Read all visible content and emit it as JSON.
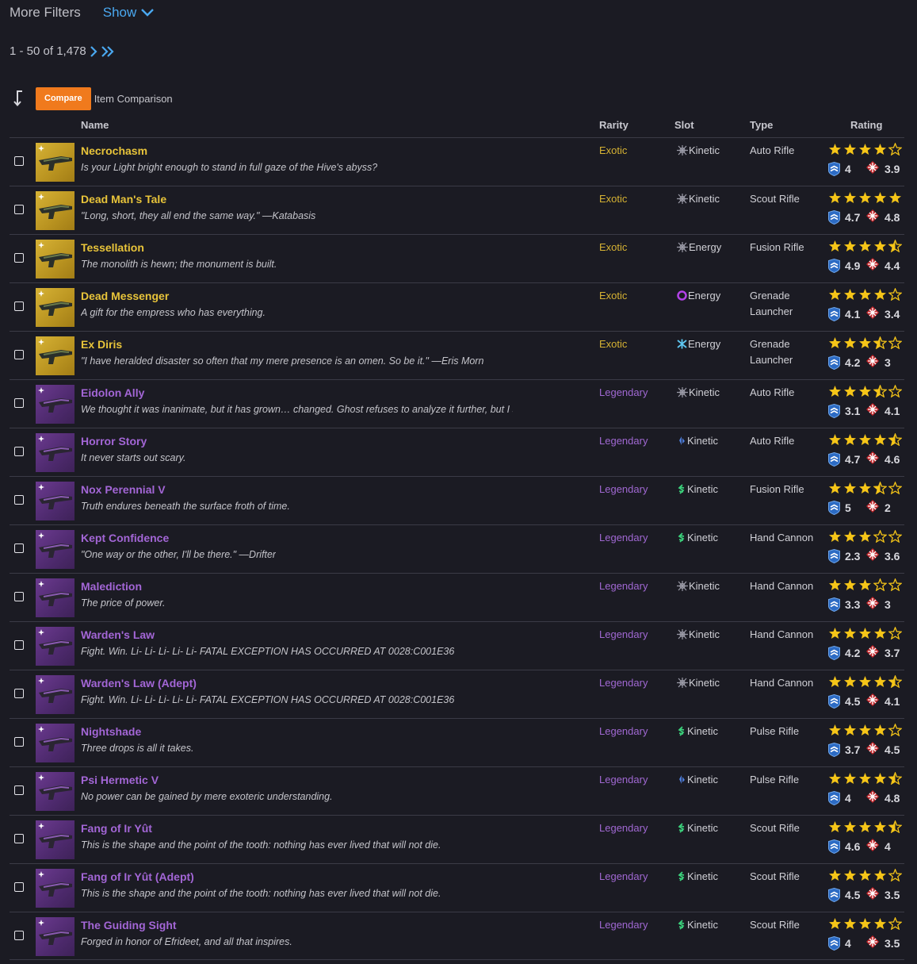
{
  "filters": {
    "label": "More Filters",
    "show_label": "Show"
  },
  "pager": {
    "range": "1 - 50 of 1,478"
  },
  "toolbar": {
    "compare_label": "Compare",
    "compare_text": "Item Comparison"
  },
  "columns": {
    "name": "Name",
    "rarity": "Rarity",
    "slot": "Slot",
    "type": "Type",
    "rating": "Rating"
  },
  "colors": {
    "exotic": "#e8c43a",
    "legendary": "#a366d6",
    "link": "#4aa8f0",
    "compare": "#f07a1d",
    "star": "#f5c518"
  },
  "items": [
    {
      "name": "Necrochasm",
      "flavor": "Is your Light bright enough to stand in full gaze of the Hive's abyss?",
      "rarity": "Exotic",
      "tier": "exotic",
      "slot": "Kinetic",
      "element": "kinetic-icon",
      "type": "Auto Rifle",
      "stars": 4,
      "pve": "4",
      "pvp": "3.9"
    },
    {
      "name": "Dead Man's Tale",
      "flavor": "\"Long, short, they all end the same way.\" —Katabasis",
      "rarity": "Exotic",
      "tier": "exotic",
      "slot": "Kinetic",
      "element": "kinetic-icon",
      "type": "Scout Rifle",
      "stars": 5,
      "pve": "4.7",
      "pvp": "4.8"
    },
    {
      "name": "Tessellation",
      "flavor": "The monolith is hewn; the monument is built.",
      "rarity": "Exotic",
      "tier": "exotic",
      "slot": "Energy",
      "element": "kinetic-icon",
      "type": "Fusion Rifle",
      "stars": 4.5,
      "pve": "4.9",
      "pvp": "4.4"
    },
    {
      "name": "Dead Messenger",
      "flavor": "A gift for the empress who has everything.",
      "rarity": "Exotic",
      "tier": "exotic",
      "slot": "Energy",
      "element": "void-icon",
      "type": "Grenade Launcher",
      "stars": 4,
      "pve": "4.1",
      "pvp": "3.4"
    },
    {
      "name": "Ex Diris",
      "flavor": "\"I have heralded disaster so often that my mere presence is an omen. So be it.\" —Eris Morn",
      "rarity": "Exotic",
      "tier": "exotic",
      "slot": "Energy",
      "element": "arc-icon",
      "type": "Grenade Launcher",
      "stars": 3.5,
      "pve": "4.2",
      "pvp": "3"
    },
    {
      "name": "Eidolon Ally",
      "flavor": "We thought it was inanimate, but it has grown… changed. Ghost refuses to analyze it further, but I s...",
      "rarity": "Legendary",
      "tier": "legendary",
      "slot": "Kinetic",
      "element": "kinetic-icon",
      "type": "Auto Rifle",
      "stars": 3.5,
      "pve": "3.1",
      "pvp": "4.1"
    },
    {
      "name": "Horror Story",
      "flavor": "It never starts out scary.",
      "rarity": "Legendary",
      "tier": "legendary",
      "slot": "Kinetic",
      "element": "stasis-icon",
      "type": "Auto Rifle",
      "stars": 4.5,
      "pve": "4.7",
      "pvp": "4.6"
    },
    {
      "name": "Nox Perennial V",
      "flavor": "Truth endures beneath the surface froth of time.",
      "rarity": "Legendary",
      "tier": "legendary",
      "slot": "Kinetic",
      "element": "strand-icon",
      "type": "Fusion Rifle",
      "stars": 3.5,
      "pve": "5",
      "pvp": "2"
    },
    {
      "name": "Kept Confidence",
      "flavor": "\"One way or the other, I'll be there.\" —Drifter",
      "rarity": "Legendary",
      "tier": "legendary",
      "slot": "Kinetic",
      "element": "strand-icon",
      "type": "Hand Cannon",
      "stars": 3,
      "pve": "2.3",
      "pvp": "3.6"
    },
    {
      "name": "Malediction",
      "flavor": "The price of power.",
      "rarity": "Legendary",
      "tier": "legendary",
      "slot": "Kinetic",
      "element": "kinetic-icon",
      "type": "Hand Cannon",
      "stars": 3,
      "pve": "3.3",
      "pvp": "3"
    },
    {
      "name": "Warden's Law",
      "flavor": "Fight. Win. Li- Li- Li- Li- Li- FATAL EXCEPTION HAS OCCURRED AT 0028:C001E36",
      "rarity": "Legendary",
      "tier": "legendary",
      "slot": "Kinetic",
      "element": "kinetic-icon",
      "type": "Hand Cannon",
      "stars": 4,
      "pve": "4.2",
      "pvp": "3.7"
    },
    {
      "name": "Warden's Law (Adept)",
      "flavor": "Fight. Win. Li- Li- Li- Li- Li- FATAL EXCEPTION HAS OCCURRED AT 0028:C001E36",
      "rarity": "Legendary",
      "tier": "legendary",
      "slot": "Kinetic",
      "element": "kinetic-icon",
      "type": "Hand Cannon",
      "stars": 4.5,
      "pve": "4.5",
      "pvp": "4.1"
    },
    {
      "name": "Nightshade",
      "flavor": "Three drops is all it takes.",
      "rarity": "Legendary",
      "tier": "legendary",
      "slot": "Kinetic",
      "element": "strand-icon",
      "type": "Pulse Rifle",
      "stars": 4,
      "pve": "3.7",
      "pvp": "4.5"
    },
    {
      "name": "Psi Hermetic V",
      "flavor": "No power can be gained by mere exoteric understanding.",
      "rarity": "Legendary",
      "tier": "legendary",
      "slot": "Kinetic",
      "element": "stasis-icon",
      "type": "Pulse Rifle",
      "stars": 4.5,
      "pve": "4",
      "pvp": "4.8"
    },
    {
      "name": "Fang of Ir Yût",
      "flavor": "This is the shape and the point of the tooth: nothing has ever lived that will not die.",
      "rarity": "Legendary",
      "tier": "legendary",
      "slot": "Kinetic",
      "element": "strand-icon",
      "type": "Scout Rifle",
      "stars": 4.5,
      "pve": "4.6",
      "pvp": "4"
    },
    {
      "name": "Fang of Ir Yût (Adept)",
      "flavor": "This is the shape and the point of the tooth: nothing has ever lived that will not die.",
      "rarity": "Legendary",
      "tier": "legendary",
      "slot": "Kinetic",
      "element": "strand-icon",
      "type": "Scout Rifle",
      "stars": 4,
      "pve": "4.5",
      "pvp": "3.5"
    },
    {
      "name": "The Guiding Sight",
      "flavor": "Forged in honor of Efrideet, and all that inspires.",
      "rarity": "Legendary",
      "tier": "legendary",
      "slot": "Kinetic",
      "element": "strand-icon",
      "type": "Scout Rifle",
      "stars": 4,
      "pve": "4",
      "pvp": "3.5"
    }
  ]
}
